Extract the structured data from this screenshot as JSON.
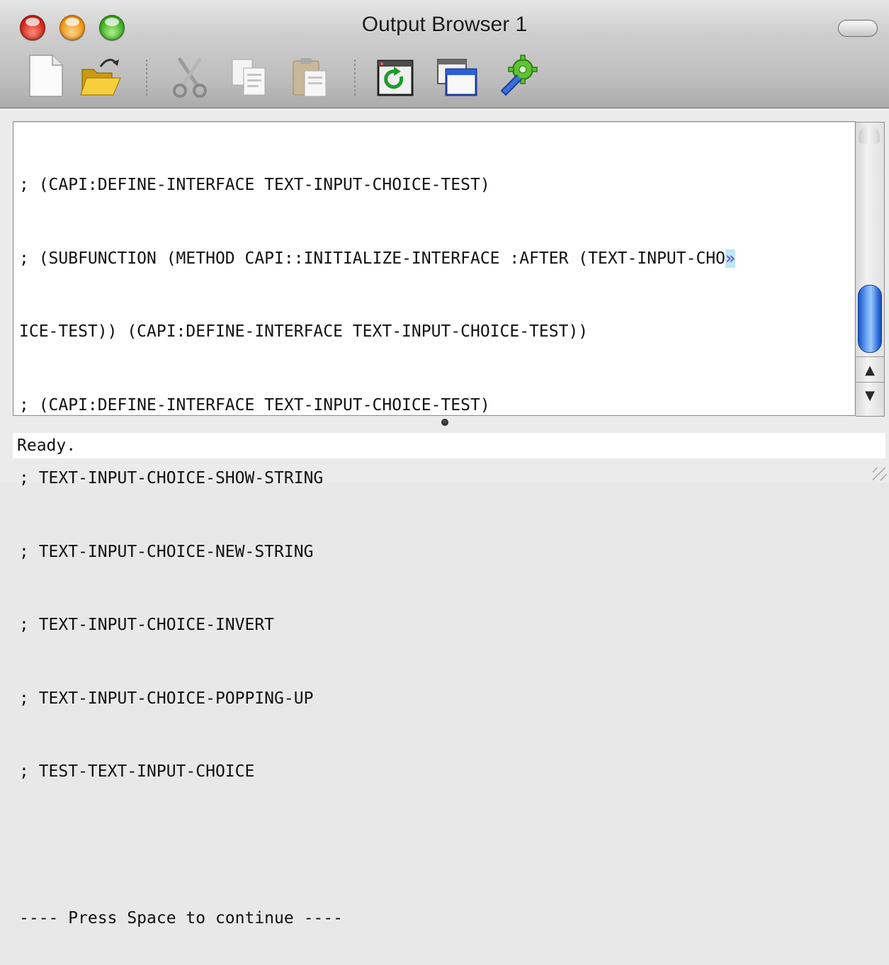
{
  "window": {
    "title": "Output Browser 1"
  },
  "titlebar": {
    "buttons": [
      "close",
      "minimize",
      "zoom"
    ],
    "toolbar_toggle": "toolbar-toggle"
  },
  "toolbar": {
    "items": [
      {
        "icon": "new-document-icon"
      },
      {
        "icon": "open-folder-icon"
      },
      {
        "icon": "cut-scissors-icon"
      },
      {
        "icon": "copy-icon"
      },
      {
        "icon": "paste-icon"
      },
      {
        "icon": "refresh-icon"
      },
      {
        "icon": "windows-icon"
      },
      {
        "icon": "preferences-gear-icon"
      }
    ]
  },
  "output": {
    "lines": [
      "; (CAPI:DEFINE-INTERFACE TEXT-INPUT-CHOICE-TEST)",
      "; (SUBFUNCTION (METHOD CAPI::INITIALIZE-INTERFACE :AFTER (TEXT-INPUT-CHO",
      "ICE-TEST)) (CAPI:DEFINE-INTERFACE TEXT-INPUT-CHOICE-TEST))",
      "; (CAPI:DEFINE-INTERFACE TEXT-INPUT-CHOICE-TEST)",
      "; TEXT-INPUT-CHOICE-SHOW-STRING",
      "; TEXT-INPUT-CHOICE-NEW-STRING",
      "; TEXT-INPUT-CHOICE-INVERT",
      "; TEXT-INPUT-CHOICE-POPPING-UP",
      "; TEST-TEXT-INPUT-CHOICE",
      "",
      "---- Press Space to continue ----"
    ],
    "wrap_marker": "»"
  },
  "status": {
    "text": "Ready."
  },
  "colors": {
    "scroll_thumb": "#3a7be6",
    "wrap_marker_bg": "#bfe6f0"
  }
}
